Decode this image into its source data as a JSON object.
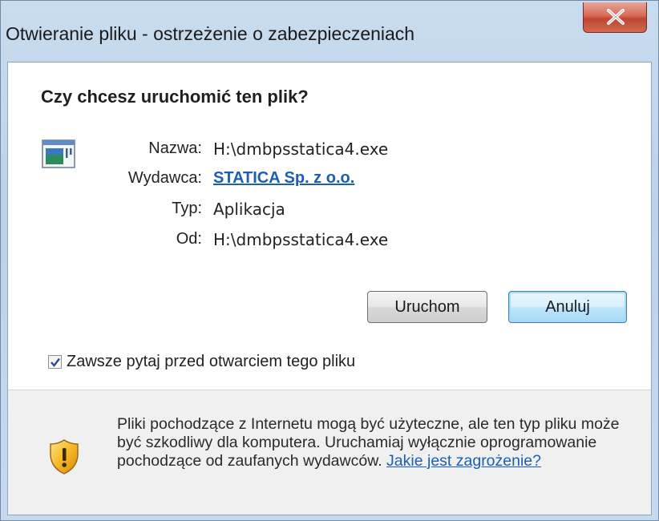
{
  "window": {
    "title": "Otwieranie pliku - ostrzeżenie o zabezpieczeniach",
    "close_icon": "close-icon"
  },
  "dialog": {
    "heading": "Czy chcesz uruchomić ten plik?",
    "fields": {
      "name_label": "Nazwa:",
      "name_value": "H:\\dmbpsstatica4.exe",
      "publisher_label": "Wydawca:",
      "publisher_value": "STATICA Sp. z o.o.",
      "type_label": "Typ:",
      "type_value": "Aplikacja",
      "from_label": "Od:",
      "from_value": "H:\\dmbpsstatica4.exe"
    },
    "buttons": {
      "run": "Uruchom",
      "cancel": "Anuluj"
    },
    "checkbox": {
      "label": "Zawsze pytaj przed otwarciem tego pliku",
      "checked": true
    },
    "warning": {
      "text": "Pliki pochodzące z Internetu mogą być użyteczne, ale ten typ pliku może być szkodliwy dla komputera. Uruchamiaj wyłącznie oprogramowanie pochodzące od zaufanych wydawców. ",
      "link": "Jakie jest zagrożenie?"
    }
  },
  "colors": {
    "link": "#1a5fb4",
    "title_bar": "#c9dcef",
    "close_button": "#c0452f"
  }
}
